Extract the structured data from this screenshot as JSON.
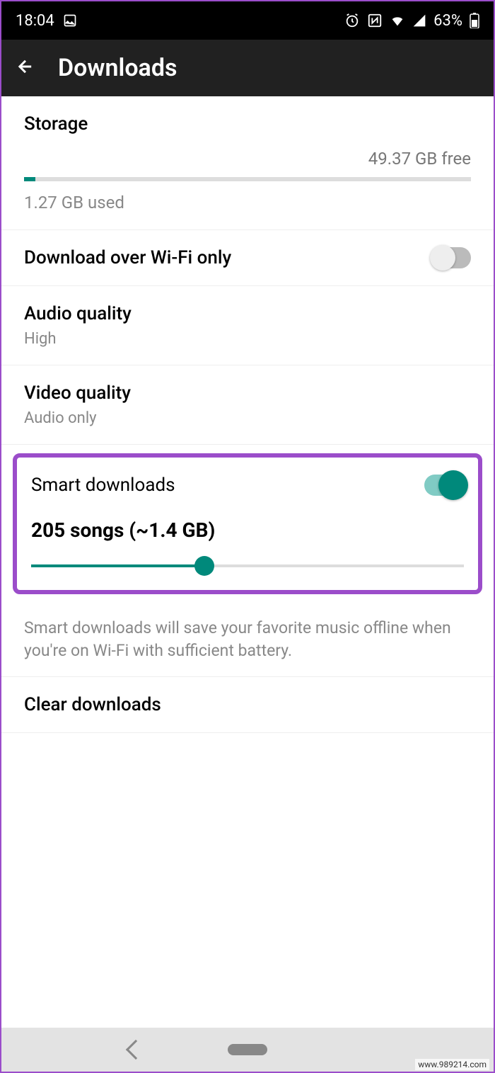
{
  "statusBar": {
    "time": "18:04",
    "battery": "63%"
  },
  "appBar": {
    "title": "Downloads"
  },
  "storage": {
    "label": "Storage",
    "free": "49.37 GB free",
    "used": "1.27 GB used"
  },
  "wifiOnly": {
    "label": "Download over Wi-Fi only",
    "enabled": false
  },
  "audioQuality": {
    "label": "Audio quality",
    "value": "High"
  },
  "videoQuality": {
    "label": "Video quality",
    "value": "Audio only"
  },
  "smartDownloads": {
    "label": "Smart downloads",
    "enabled": true,
    "songsText": "205 songs (~1.4 GB)",
    "description": "Smart downloads will save your favorite music offline when you're on Wi-Fi with sufficient battery."
  },
  "clearDownloads": {
    "label": "Clear downloads"
  },
  "watermark": "www.989214.com"
}
